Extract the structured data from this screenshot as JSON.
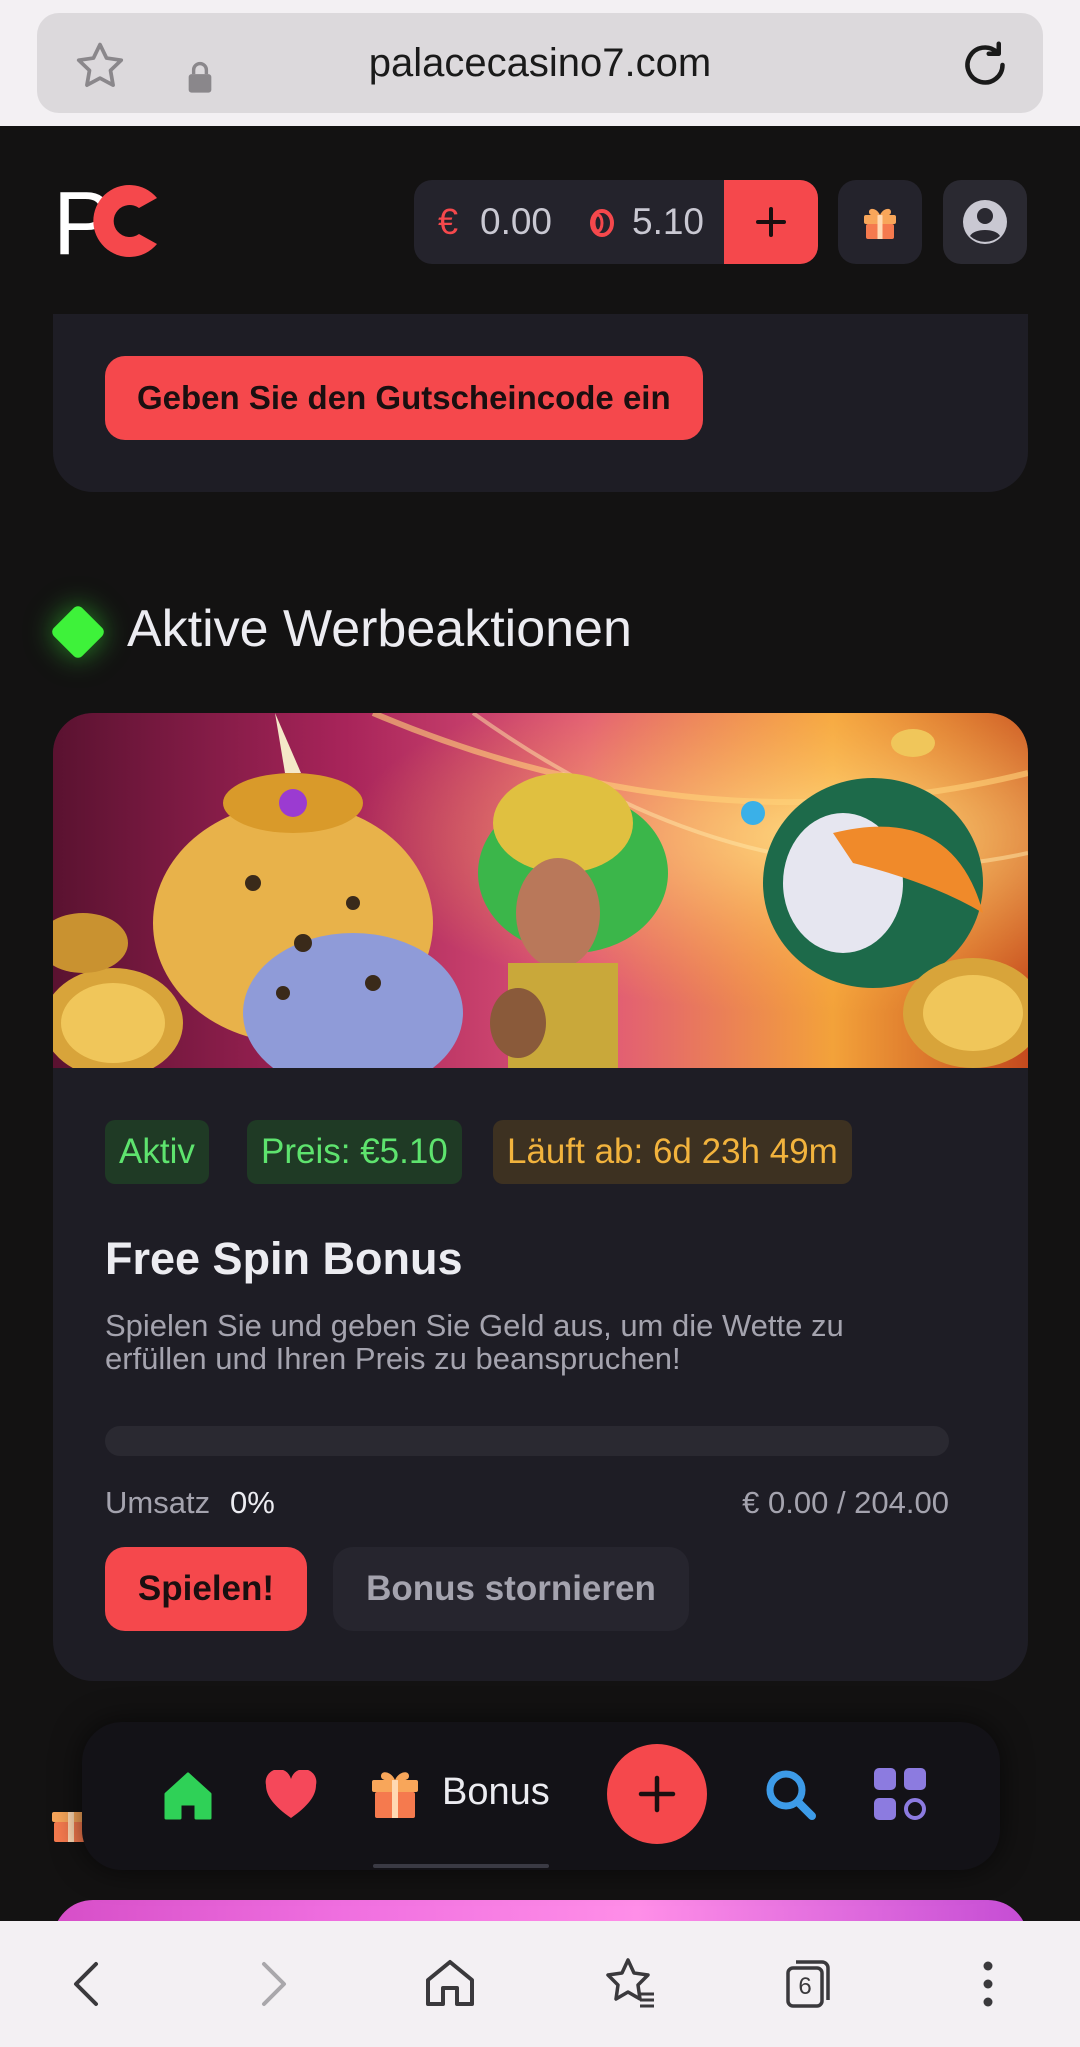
{
  "browser": {
    "url": "palacecasino7.com",
    "tab_count": "6"
  },
  "header": {
    "logo_text": "PC",
    "balance_currency": "€",
    "balance": "0.00",
    "coins": "5.10",
    "add_label": "+"
  },
  "voucher": {
    "button_label": "Geben Sie den Gutscheincode ein"
  },
  "section": {
    "title": "Aktive Werbeaktionen"
  },
  "promo": {
    "status": "Aktiv",
    "prize": "Preis: €5.10",
    "expires": "Läuft ab: 6d 23h 49m",
    "title": "Free Spin Bonus",
    "description": "Spielen Sie und geben Sie Geld aus, um die Wette zu erfüllen und Ihren Preis zu beanspruchen!",
    "wager_label": "Umsatz",
    "wager_percent": "0%",
    "progress_fraction": 0,
    "wager_amount": "€ 0.00 / 204.00",
    "play_label": "Spielen!",
    "cancel_label": "Bonus stornieren"
  },
  "app_nav": {
    "bonus_label": "Bonus"
  },
  "colors": {
    "accent": "#f5484c",
    "active_green": "#5ee36e",
    "expire_orange": "#f2b33d",
    "card_bg": "#1e1d25",
    "page_bg": "#131212"
  },
  "icons": [
    "star-icon",
    "lock-icon",
    "reload-icon",
    "gift-icon",
    "user-icon",
    "coin-icon",
    "home-icon",
    "heart-icon",
    "plus-icon",
    "search-icon",
    "apps-icon",
    "back-icon",
    "forward-icon",
    "browser-home-icon",
    "bookmarks-icon",
    "tabs-icon",
    "menu-icon"
  ]
}
